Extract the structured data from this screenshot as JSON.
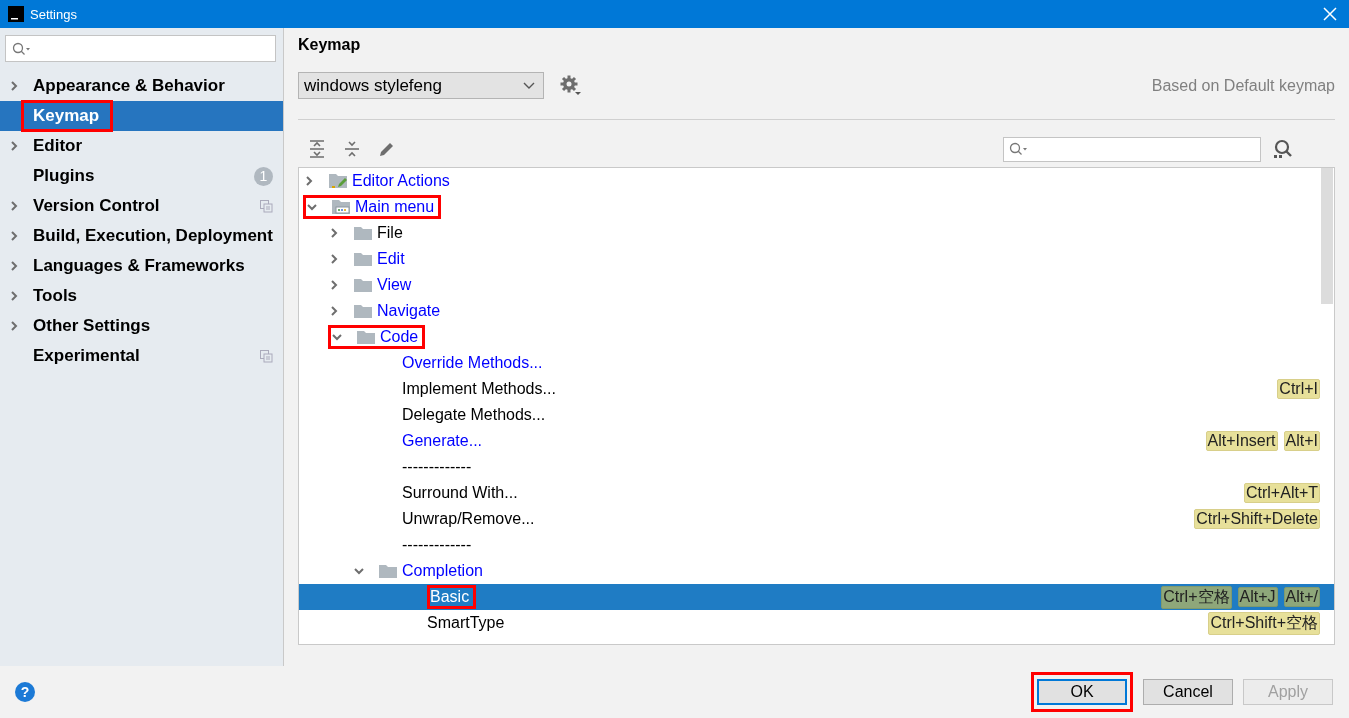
{
  "window": {
    "title": "Settings"
  },
  "sidebar": {
    "items": [
      {
        "label": "Appearance & Behavior",
        "expandable": true,
        "selected": false,
        "annotated": false
      },
      {
        "label": "Keymap",
        "expandable": false,
        "selected": true,
        "annotated": true
      },
      {
        "label": "Editor",
        "expandable": true,
        "selected": false,
        "annotated": false
      },
      {
        "label": "Plugins",
        "expandable": false,
        "selected": false,
        "annotated": false,
        "badge": "1"
      },
      {
        "label": "Version Control",
        "expandable": true,
        "selected": false,
        "annotated": false,
        "project_scoped": true
      },
      {
        "label": "Build, Execution, Deployment",
        "expandable": true,
        "selected": false,
        "annotated": false
      },
      {
        "label": "Languages & Frameworks",
        "expandable": true,
        "selected": false,
        "annotated": false
      },
      {
        "label": "Tools",
        "expandable": true,
        "selected": false,
        "annotated": false
      },
      {
        "label": "Other Settings",
        "expandable": true,
        "selected": false,
        "annotated": false
      },
      {
        "label": "Experimental",
        "expandable": false,
        "selected": false,
        "annotated": false,
        "project_scoped": true
      }
    ]
  },
  "keymap": {
    "title": "Keymap",
    "scheme": "windows stylefeng",
    "based_on": "Based on Default keymap",
    "tree": [
      {
        "kind": "editor-actions",
        "label": "Editor Actions",
        "modified": true,
        "expanded": false,
        "selected": false,
        "annotated": false
      },
      {
        "kind": "main-menu",
        "label": "Main menu",
        "modified": true,
        "expanded": true,
        "selected": false,
        "annotated": true,
        "children": [
          {
            "kind": "folder",
            "label": "File",
            "modified": false,
            "expanded": false,
            "selected": false,
            "annotated": false
          },
          {
            "kind": "folder",
            "label": "Edit",
            "modified": true,
            "expanded": false,
            "selected": false,
            "annotated": false
          },
          {
            "kind": "folder",
            "label": "View",
            "modified": true,
            "expanded": false,
            "selected": false,
            "annotated": false
          },
          {
            "kind": "folder",
            "label": "Navigate",
            "modified": true,
            "expanded": false,
            "selected": false,
            "annotated": false
          },
          {
            "kind": "folder",
            "label": "Code",
            "modified": true,
            "expanded": true,
            "selected": false,
            "annotated": true,
            "children": [
              {
                "kind": "action",
                "label": "Override Methods...",
                "modified": true,
                "selected": false,
                "annotated": false
              },
              {
                "kind": "action",
                "label": "Implement Methods...",
                "modified": false,
                "selected": false,
                "annotated": false,
                "shortcuts": [
                  "Ctrl+I"
                ]
              },
              {
                "kind": "action",
                "label": "Delegate Methods...",
                "modified": false,
                "selected": false,
                "annotated": false
              },
              {
                "kind": "action",
                "label": "Generate...",
                "modified": true,
                "selected": false,
                "annotated": false,
                "shortcuts": [
                  "Alt+Insert",
                  "Alt+I"
                ]
              },
              {
                "kind": "action",
                "label": "-------------",
                "modified": false,
                "selected": false,
                "annotated": false
              },
              {
                "kind": "action",
                "label": "Surround With...",
                "modified": false,
                "selected": false,
                "annotated": false,
                "shortcuts": [
                  "Ctrl+Alt+T"
                ]
              },
              {
                "kind": "action",
                "label": "Unwrap/Remove...",
                "modified": false,
                "selected": false,
                "annotated": false,
                "shortcuts": [
                  "Ctrl+Shift+Delete"
                ]
              },
              {
                "kind": "action",
                "label": "-------------",
                "modified": false,
                "selected": false,
                "annotated": false
              },
              {
                "kind": "folder",
                "label": "Completion",
                "modified": true,
                "expanded": true,
                "selected": false,
                "annotated": false,
                "children": [
                  {
                    "kind": "action",
                    "label": "Basic",
                    "modified": false,
                    "selected": true,
                    "annotated": true,
                    "shortcuts": [
                      "Ctrl+空格",
                      "Alt+J",
                      "Alt+/"
                    ]
                  },
                  {
                    "kind": "action",
                    "label": "SmartType",
                    "modified": false,
                    "selected": false,
                    "annotated": false,
                    "shortcuts": [
                      "Ctrl+Shift+空格"
                    ]
                  }
                ]
              }
            ]
          }
        ]
      }
    ]
  },
  "footer": {
    "help": "?",
    "buttons": [
      {
        "label": "OK",
        "focused": true,
        "disabled": false,
        "annotated": true
      },
      {
        "label": "Cancel",
        "focused": false,
        "disabled": false,
        "annotated": false
      },
      {
        "label": "Apply",
        "focused": false,
        "disabled": true,
        "annotated": false
      }
    ]
  }
}
